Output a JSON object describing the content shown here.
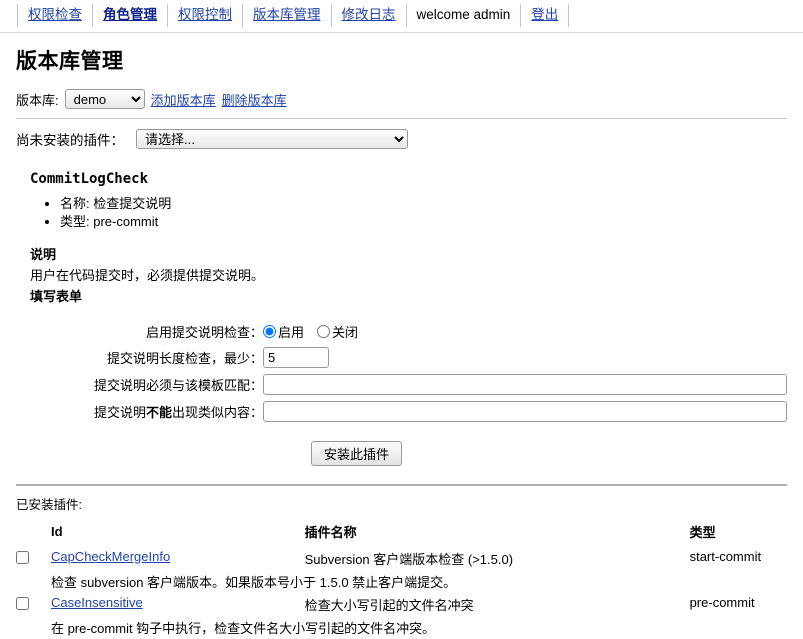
{
  "nav": {
    "items": [
      {
        "label": "权限检查",
        "active": false,
        "link": true
      },
      {
        "label": "角色管理",
        "active": true,
        "link": true
      },
      {
        "label": "权限控制",
        "active": false,
        "link": true
      },
      {
        "label": "版本库管理",
        "active": false,
        "link": true
      },
      {
        "label": "修改日志",
        "active": false,
        "link": true
      },
      {
        "label": "welcome admin",
        "active": false,
        "link": false
      },
      {
        "label": "登出",
        "active": false,
        "link": true
      }
    ]
  },
  "page": {
    "title": "版本库管理"
  },
  "repo": {
    "label": "版本库:",
    "selected": "demo",
    "options": [
      "demo"
    ],
    "add_link": "添加版本库",
    "delete_link": "删除版本库"
  },
  "uninstalled": {
    "label": "尚未安装的插件：",
    "selected": "请选择...",
    "options": [
      "请选择..."
    ]
  },
  "plugin": {
    "name": "CommitLogCheck",
    "meta": [
      {
        "key": "名称",
        "value": "检查提交说明"
      },
      {
        "key": "类型",
        "value": "pre-commit"
      }
    ],
    "desc_title": "说明",
    "desc_body": "用户在代码提交时，必须提供提交说明。",
    "form_title": "填写表单"
  },
  "form": {
    "rows": [
      {
        "label_pre": "启用提交说明检查：",
        "label_bold": "",
        "label_post": "",
        "type": "radio",
        "options": [
          {
            "label": "启用",
            "checked": true
          },
          {
            "label": "关闭",
            "checked": false
          }
        ]
      },
      {
        "label_pre": "提交说明长度检查，最少：",
        "label_bold": "",
        "label_post": "",
        "type": "number",
        "value": "5"
      },
      {
        "label_pre": "提交说明必须与该模板匹配：",
        "label_bold": "",
        "label_post": "",
        "type": "text",
        "value": ""
      },
      {
        "label_pre": "提交说明",
        "label_bold": "不能",
        "label_post": "出现类似内容：",
        "type": "text",
        "value": ""
      }
    ],
    "submit_label": "安装此插件"
  },
  "installed": {
    "caption": "已安装插件:",
    "columns": {
      "checkbox": "",
      "id": "Id",
      "name": "插件名称",
      "type": "类型"
    },
    "rows": [
      {
        "checked": false,
        "id": "CapCheckMergeInfo",
        "name": "Subversion 客户端版本检查 (>1.5.0)",
        "type": "start-commit",
        "desc": "检查 subversion 客户端版本。如果版本号小于 1.5.0  禁止客户端提交。"
      },
      {
        "checked": false,
        "id": "CaseInsensitive",
        "name": "检查大小写引起的文件名冲突",
        "type": "pre-commit",
        "desc": "在 pre-commit 钩子中执行，检查文件名大小写引起的文件名冲突。"
      }
    ]
  },
  "colors": {
    "link": "#2244aa",
    "link_active": "#11228c",
    "border": "#9a9a9a",
    "rule": "#c8c8c8"
  }
}
